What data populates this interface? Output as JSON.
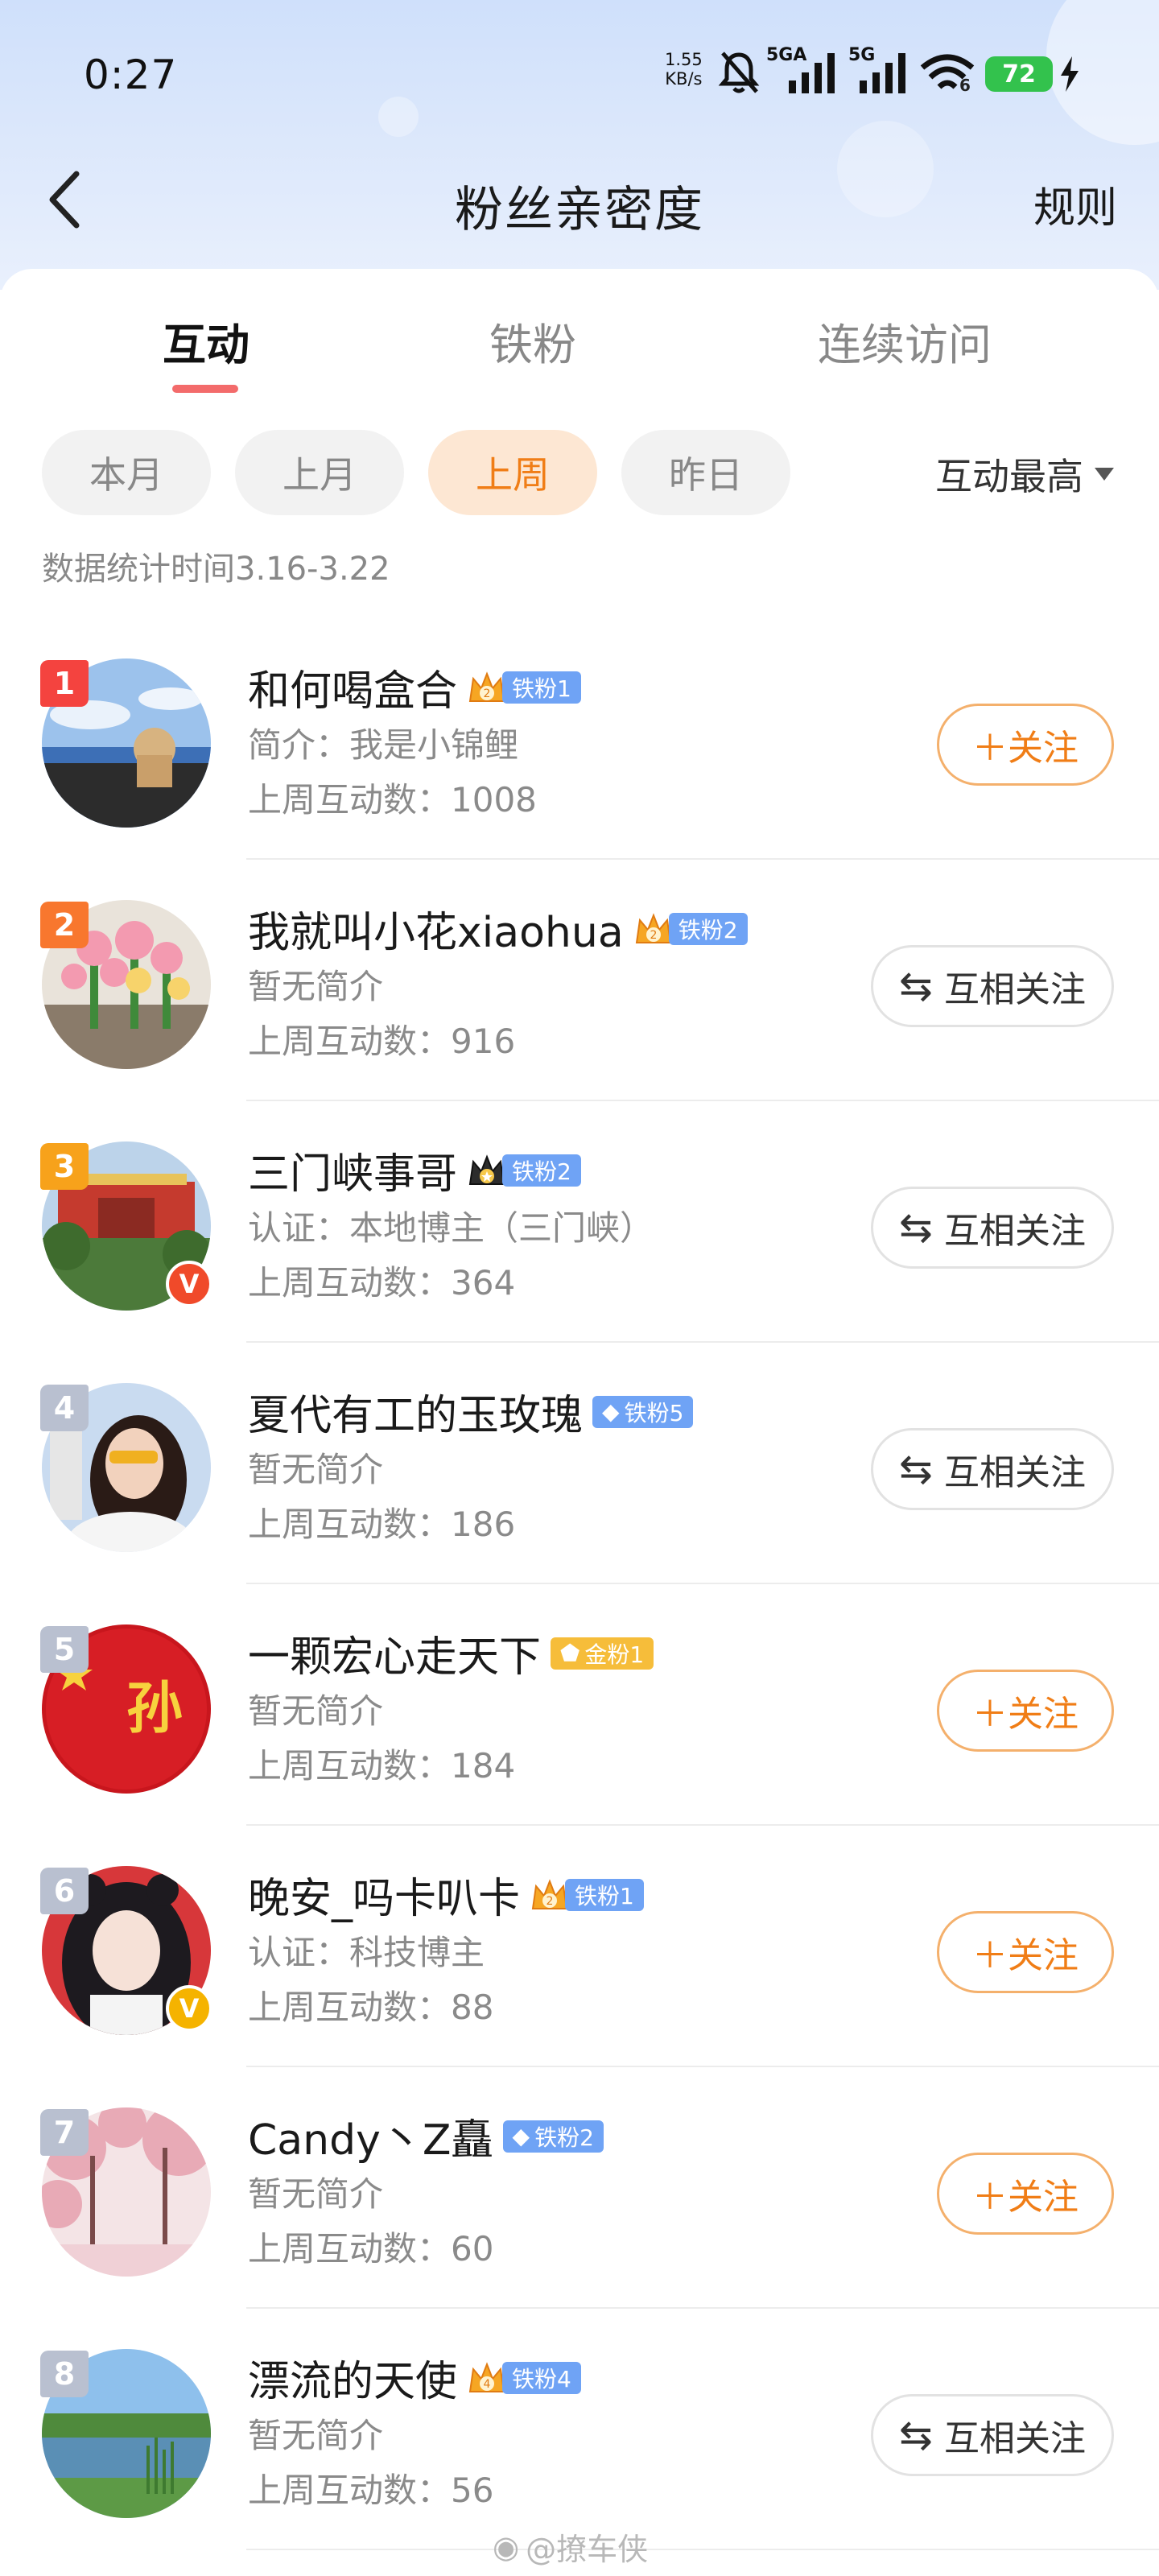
{
  "status_bar": {
    "time": "0:27",
    "net_speed_value": "1.55",
    "net_speed_unit": "KB/s",
    "signal_1_label": "5GA",
    "signal_2_label": "5G",
    "wifi_sub": "6",
    "battery": "72",
    "battery_color": "#33c24d"
  },
  "header": {
    "back_icon": "chevron-left-icon",
    "title": "粉丝亲密度",
    "rules": "规则"
  },
  "tabs": [
    {
      "label": "互动",
      "active": true
    },
    {
      "label": "铁粉",
      "active": false
    },
    {
      "label": "连续访问",
      "active": false
    }
  ],
  "filters": {
    "chips": [
      {
        "label": "本月",
        "active": false
      },
      {
        "label": "上月",
        "active": false
      },
      {
        "label": "上周",
        "active": true
      },
      {
        "label": "昨日",
        "active": false
      }
    ],
    "sort": "互动最高",
    "stat_period": "数据统计时间3.16-3.22"
  },
  "count_label": "上周互动数：",
  "fans": [
    {
      "rank": "1",
      "name": "和何喝盒合",
      "badge": "铁粉1",
      "badge_level": "2",
      "desc": "简介：我是小锦鲤",
      "count": "1008",
      "action": "＋关注",
      "action_type": "follow",
      "verified": ""
    },
    {
      "rank": "2",
      "name": "我就叫小花xiaohua",
      "badge": "铁粉2",
      "badge_level": "2",
      "desc": "暂无简介",
      "count": "916",
      "action": "互相关注",
      "action_type": "mutual",
      "verified": ""
    },
    {
      "rank": "3",
      "name": "三门峡事哥",
      "badge": "铁粉2",
      "badge_level": "",
      "desc": "认证：本地博主（三门峡）",
      "count": "364",
      "action": "互相关注",
      "action_type": "mutual",
      "verified": "red"
    },
    {
      "rank": "4",
      "name": "夏代有工的玉玫瑰",
      "badge": "铁粉5",
      "badge_level": "",
      "desc": "暂无简介",
      "count": "186",
      "action": "互相关注",
      "action_type": "mutual",
      "verified": ""
    },
    {
      "rank": "5",
      "name": "一颗宏心走天下",
      "badge": "金粉1",
      "badge_level": "",
      "desc": "暂无简介",
      "count": "184",
      "action": "＋关注",
      "action_type": "follow",
      "verified": ""
    },
    {
      "rank": "6",
      "name": "晚安_吗卡叭卡",
      "badge": "铁粉1",
      "badge_level": "2",
      "desc": "认证：科技博主",
      "count": "88",
      "action": "＋关注",
      "action_type": "follow",
      "verified": "gold"
    },
    {
      "rank": "7",
      "name": "Candy丶Z矗",
      "badge": "铁粉2",
      "badge_level": "",
      "desc": "暂无简介",
      "count": "60",
      "action": "＋关注",
      "action_type": "follow",
      "verified": ""
    },
    {
      "rank": "8",
      "name": "漂流的天使",
      "badge": "铁粉4",
      "badge_level": "4",
      "desc": "暂无简介",
      "count": "56",
      "action": "互相关注",
      "action_type": "mutual",
      "verified": ""
    }
  ],
  "avatar_5_text": "孙",
  "watermark": "@撩车侠",
  "colors": {
    "accent": "#f07d16",
    "tab_indicator": "#f36b6b",
    "rank_1": "#f4433f",
    "rank_2": "#f8772e",
    "rank_3": "#f7a21b",
    "rank_other": "#b9c0d0",
    "iron_badge": "#6fa3f5",
    "gold_badge": "#f6bd3a"
  }
}
